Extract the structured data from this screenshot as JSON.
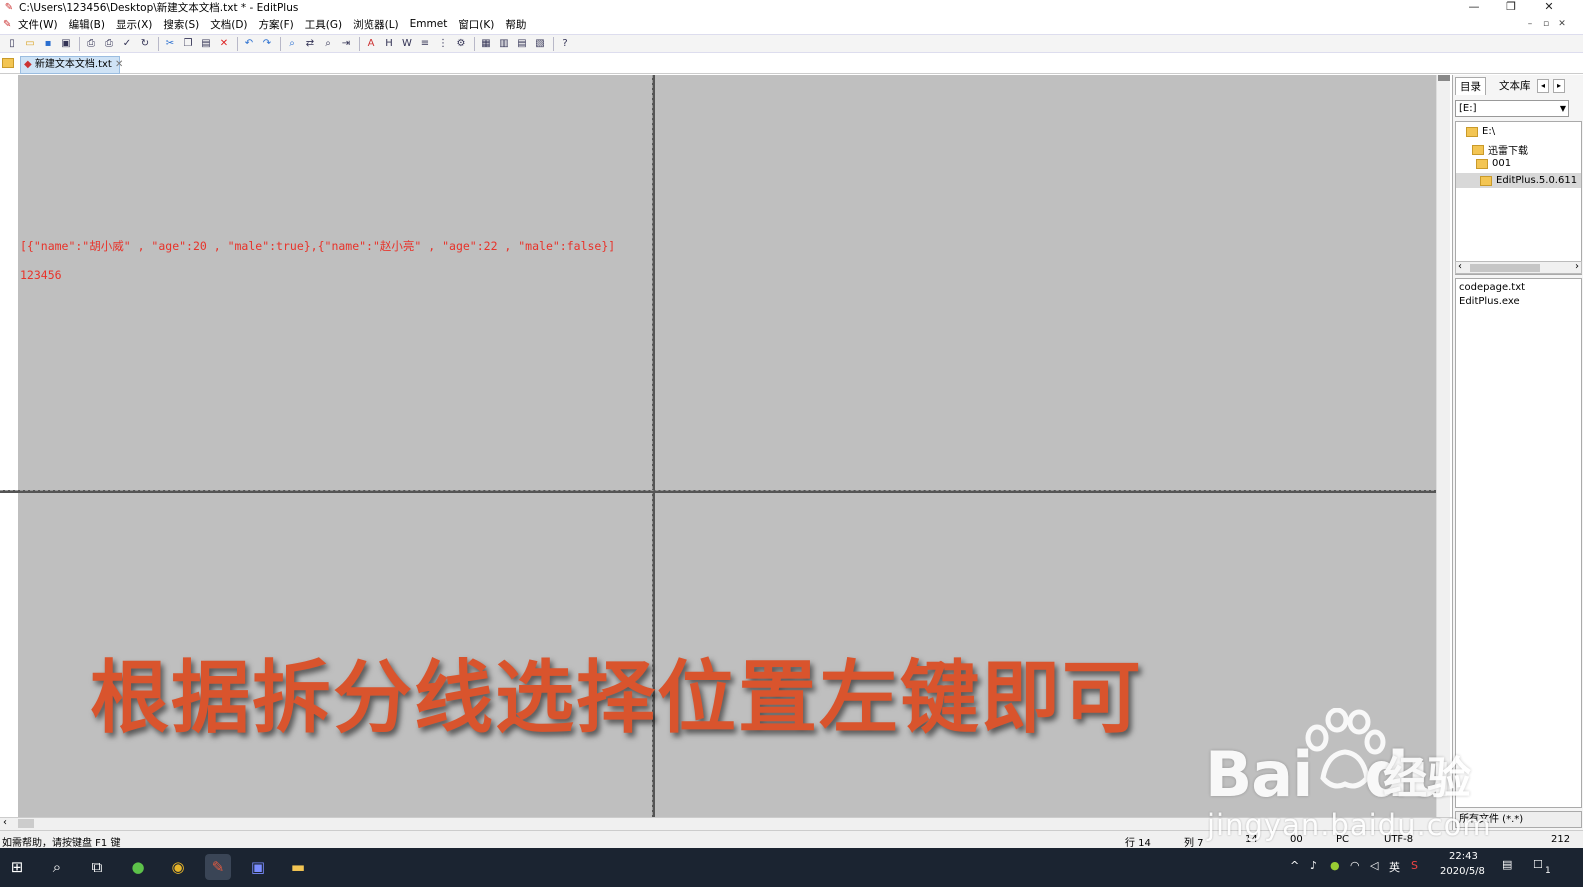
{
  "window": {
    "title": "C:\\Users\\123456\\Desktop\\新建文本文档.txt * - EditPlus",
    "controls": {
      "minimize": "—",
      "restore": "❐",
      "close": "✕"
    },
    "mdi_controls": {
      "minimize": "–",
      "restore": "▫",
      "close": "✕"
    }
  },
  "menu": [
    "文件(W)",
    "编辑(B)",
    "显示(X)",
    "搜索(S)",
    "文档(D)",
    "方案(F)",
    "工具(G)",
    "浏览器(L)",
    "Emmet",
    "窗口(K)",
    "帮助"
  ],
  "toolbar_icons": [
    "new-file-icon",
    "open-file-icon",
    "save-icon",
    "save-all-icon",
    "sep",
    "print-preview-icon",
    "print-icon",
    "spellcheck-icon",
    "reload-icon",
    "sep",
    "cut-icon",
    "copy-icon",
    "paste-icon",
    "delete-icon",
    "sep",
    "undo-icon",
    "redo-icon",
    "sep",
    "find-icon",
    "replace-icon",
    "find-in-files-icon",
    "goto-icon",
    "sep",
    "font-icon",
    "hex-icon",
    "word-wrap-icon",
    "line-number-icon",
    "column-icon",
    "settings-icon",
    "sep",
    "browser-icon",
    "cliptext-icon",
    "output-icon",
    "dirwin-icon",
    "sep",
    "help-icon"
  ],
  "tab": {
    "label": "新建文本文档.txt"
  },
  "editor": {
    "line1": "[{\"name\":\"胡小威\" , \"age\":20 , \"male\":true},{\"name\":\"赵小亮\" , \"age\":22 , \"male\":false}]",
    "line2": "123456"
  },
  "caption": "根据拆分线选择位置左键即可",
  "right_panel": {
    "tabs": [
      "目录",
      "文本库"
    ],
    "drive": "[E:]",
    "tree": [
      "E:\\",
      "迅雷下载",
      "001",
      "EditPlus.5.0.611"
    ],
    "files": [
      "codepage.txt",
      "EditPlus.exe"
    ],
    "filter": "所有文件 (*.*)"
  },
  "status": {
    "help": "如需帮助，请按键盘 F1 键",
    "row": "行 14",
    "col": "列 7",
    "lines": "14",
    "mode": "00",
    "eol": "PC",
    "encoding": "UTF-8",
    "size": "212"
  },
  "taskbar": {
    "apps": [
      "windows-start-icon",
      "search-icon",
      "task-view-icon",
      "360-browser-icon",
      "chrome-icon",
      "editplus-icon",
      "app-icon",
      "file-explorer-icon"
    ],
    "tray": {
      "ime": "英",
      "time": "22:43",
      "date": "2020/5/8",
      "notifications": "1"
    }
  },
  "watermark": {
    "brand": "Bai",
    "brand2": "du",
    "cn": "经验",
    "url": "jingyan.baidu.com"
  },
  "colors": {
    "code": "#e8332a",
    "caption": "#d9542d",
    "pane": "#bfbfbf",
    "taskbar": "#1b2431"
  }
}
